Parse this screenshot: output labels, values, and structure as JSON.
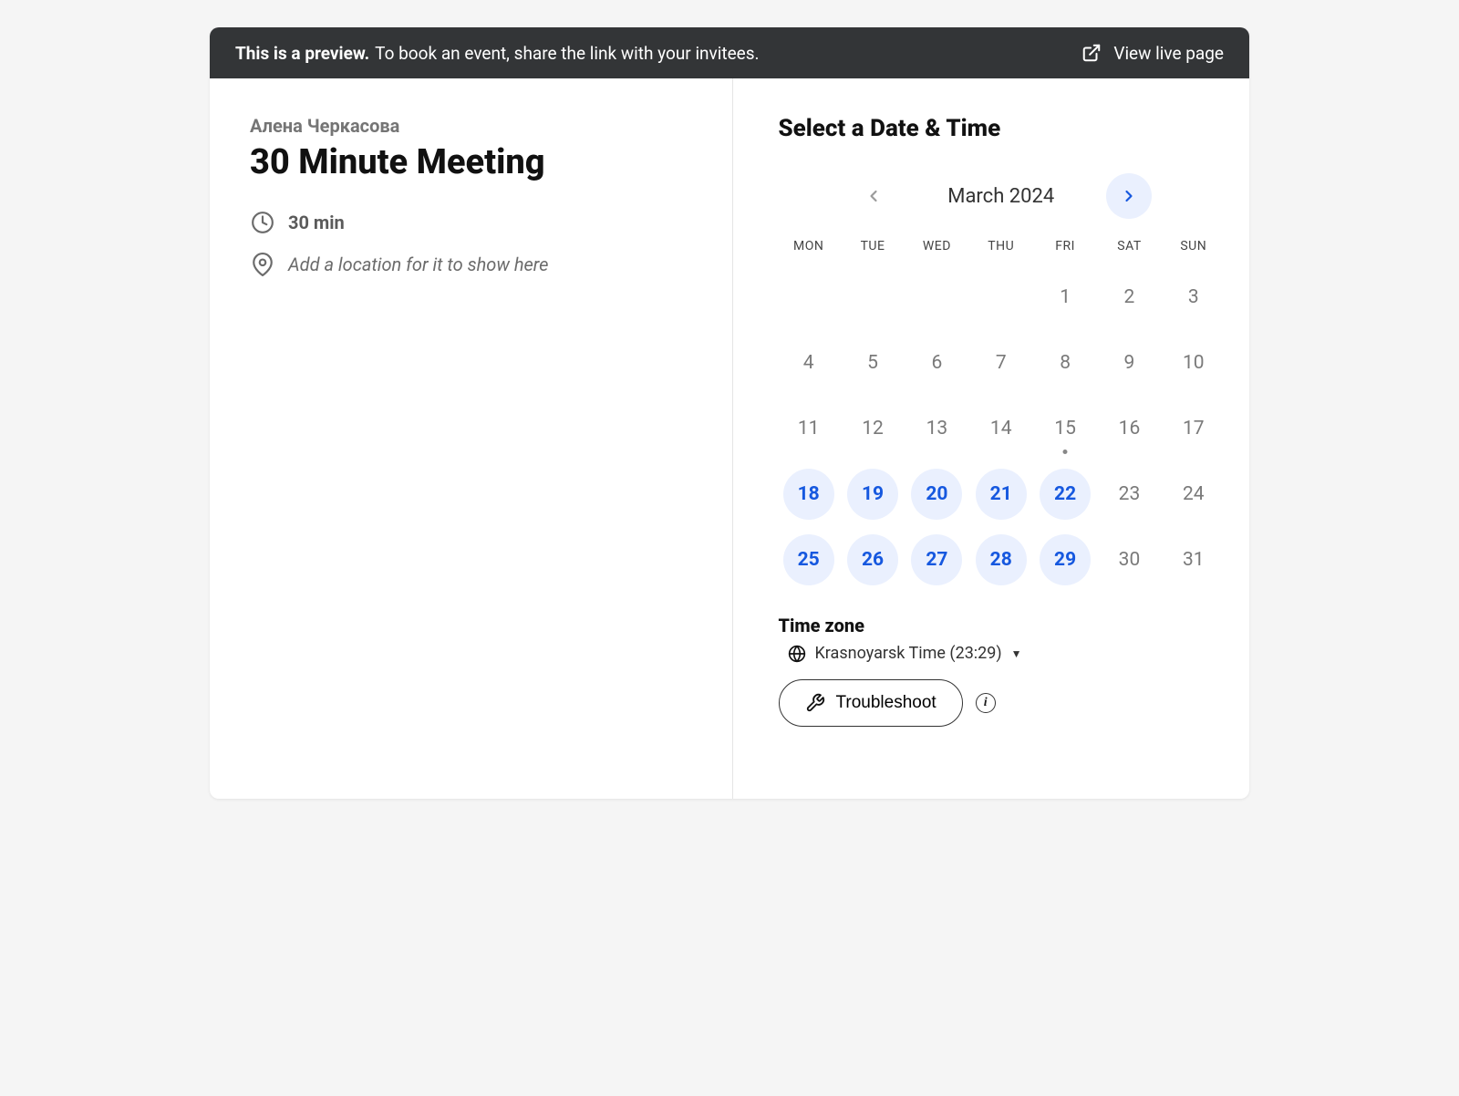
{
  "preview": {
    "bold": "This is a preview.",
    "rest": "To book an event, share the link with your invitees.",
    "view_live": "View live page"
  },
  "event": {
    "host": "Алена Черкасова",
    "title": "30 Minute Meeting",
    "duration": "30 min",
    "location_placeholder": "Add a location for it to show here"
  },
  "calendar": {
    "title": "Select a Date & Time",
    "month_label": "March 2024",
    "weekdays": [
      "MON",
      "TUE",
      "WED",
      "THU",
      "FRI",
      "SAT",
      "SUN"
    ],
    "days": [
      {
        "n": "",
        "state": "blank"
      },
      {
        "n": "",
        "state": "blank"
      },
      {
        "n": "",
        "state": "blank"
      },
      {
        "n": "",
        "state": "blank"
      },
      {
        "n": "1",
        "state": "disabled"
      },
      {
        "n": "2",
        "state": "disabled"
      },
      {
        "n": "3",
        "state": "disabled"
      },
      {
        "n": "4",
        "state": "disabled"
      },
      {
        "n": "5",
        "state": "disabled"
      },
      {
        "n": "6",
        "state": "disabled"
      },
      {
        "n": "7",
        "state": "disabled"
      },
      {
        "n": "8",
        "state": "disabled"
      },
      {
        "n": "9",
        "state": "disabled"
      },
      {
        "n": "10",
        "state": "disabled"
      },
      {
        "n": "11",
        "state": "disabled"
      },
      {
        "n": "12",
        "state": "disabled"
      },
      {
        "n": "13",
        "state": "disabled"
      },
      {
        "n": "14",
        "state": "disabled"
      },
      {
        "n": "15",
        "state": "disabled",
        "today": true
      },
      {
        "n": "16",
        "state": "disabled"
      },
      {
        "n": "17",
        "state": "disabled"
      },
      {
        "n": "18",
        "state": "available"
      },
      {
        "n": "19",
        "state": "available"
      },
      {
        "n": "20",
        "state": "available"
      },
      {
        "n": "21",
        "state": "available"
      },
      {
        "n": "22",
        "state": "available"
      },
      {
        "n": "23",
        "state": "disabled"
      },
      {
        "n": "24",
        "state": "disabled"
      },
      {
        "n": "25",
        "state": "available"
      },
      {
        "n": "26",
        "state": "available"
      },
      {
        "n": "27",
        "state": "available"
      },
      {
        "n": "28",
        "state": "available"
      },
      {
        "n": "29",
        "state": "available"
      },
      {
        "n": "30",
        "state": "disabled"
      },
      {
        "n": "31",
        "state": "disabled"
      }
    ]
  },
  "timezone": {
    "label": "Time zone",
    "value": "Krasnoyarsk Time (23:29)"
  },
  "troubleshoot": {
    "label": "Troubleshoot"
  }
}
